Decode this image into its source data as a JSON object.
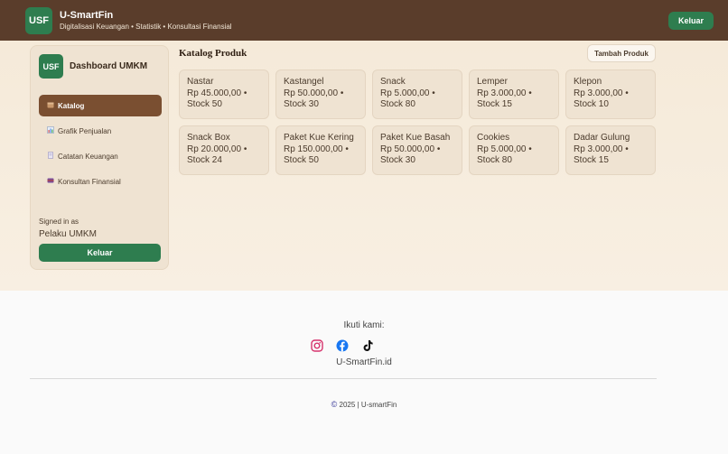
{
  "header": {
    "logo": "USF",
    "title": "U-SmartFin",
    "subtitle": "Digitalisasi Keuangan • Statistik • Konsultasi Finansial",
    "logout_label": "Keluar"
  },
  "sidebar": {
    "logo": "USF",
    "title": "Dashboard UMKM",
    "items": [
      {
        "label": "Katalog",
        "icon": "box-icon"
      },
      {
        "label": "Grafik Penjualan",
        "icon": "chart-icon"
      },
      {
        "label": "Catatan Keuangan",
        "icon": "note-icon"
      },
      {
        "label": "Konsultan Finansial",
        "icon": "consultant-icon"
      }
    ],
    "signed_label": "Signed in as",
    "signed_user": "Pelaku UMKM",
    "logout_label": "Keluar"
  },
  "catalog": {
    "title": "Katalog Produk",
    "add_label": "Tambah Produk",
    "products": [
      {
        "name": "Nastar",
        "meta": "Rp 45.000,00 • Stock 50"
      },
      {
        "name": "Kastangel",
        "meta": "Rp 50.000,00 • Stock 30"
      },
      {
        "name": "Snack",
        "meta": "Rp 5.000,00 • Stock 80"
      },
      {
        "name": "Lemper",
        "meta": "Rp 3.000,00 • Stock 15"
      },
      {
        "name": "Klepon",
        "meta": "Rp 3.000,00 • Stock 10"
      },
      {
        "name": "Snack Box",
        "meta": "Rp 20.000,00 • Stock 24"
      },
      {
        "name": "Paket Kue Kering",
        "meta": "Rp 150.000,00 • Stock 50"
      },
      {
        "name": "Paket Kue Basah",
        "meta": "Rp 50.000,00 • Stock 30"
      },
      {
        "name": "Cookies",
        "meta": "Rp 5.000,00 • Stock 80"
      },
      {
        "name": "Dadar Gulung",
        "meta": "Rp 3.000,00 • Stock 15"
      }
    ]
  },
  "footer": {
    "follow_label": "Ikuti kami:",
    "socials": [
      "instagram-icon",
      "facebook-icon",
      "tiktok-icon"
    ],
    "site": "U-SmartFin.id",
    "copyright": "2025 | U-smartFin"
  },
  "colors": {
    "header_bg": "#5a3d2b",
    "accent_green": "#2e7d4f",
    "active_nav": "#7a4f31"
  }
}
